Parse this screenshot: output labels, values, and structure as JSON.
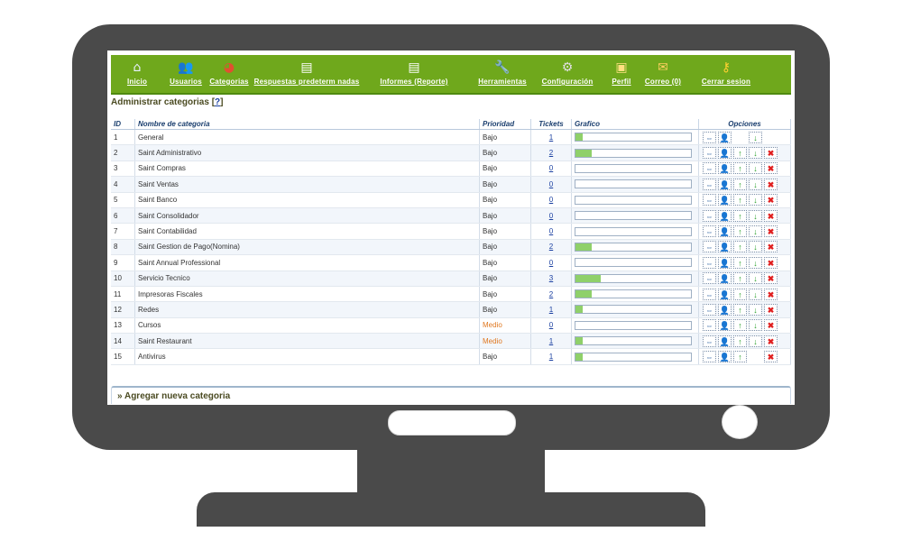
{
  "nav": {
    "items": [
      {
        "label": "Inicio",
        "icon": "home-icon",
        "glyph": "⌂",
        "color": "#e8f0ff"
      },
      {
        "label": "Usuarios",
        "icon": "users-icon",
        "glyph": "👥",
        "color": "#bcd8ff"
      },
      {
        "label": "Categorias",
        "icon": "pie-chart-icon",
        "glyph": "◕",
        "color": "#e05030"
      },
      {
        "label": "Respuestas predeterm nadas",
        "icon": "document-add-icon",
        "glyph": "▤",
        "color": "#ffffff"
      },
      {
        "label": "Informes (Reporte)",
        "icon": "report-icon",
        "glyph": "▤",
        "color": "#ffffff"
      },
      {
        "label": "Herramientas",
        "icon": "wrench-icon",
        "glyph": "🔧",
        "color": "#c0d8ff"
      },
      {
        "label": "Configuración",
        "icon": "gear-icon",
        "glyph": "⚙",
        "color": "#e0e0e0"
      },
      {
        "label": "Perfil",
        "icon": "profile-card-icon",
        "glyph": "▣",
        "color": "#ffe080"
      },
      {
        "label": "Correo (0)",
        "icon": "mail-icon",
        "glyph": "✉",
        "color": "#ffd060"
      },
      {
        "label": "Cerrar sesion",
        "icon": "key-icon",
        "glyph": "⚷",
        "color": "#ffd030"
      }
    ]
  },
  "page": {
    "title": "Administrar categorias",
    "help": "?"
  },
  "table": {
    "headers": {
      "id": "ID",
      "name": "Nombre de categoria",
      "priority": "Prioridad",
      "tickets": "Tickets",
      "graph": "Grafico",
      "options": "Opciones"
    },
    "rows": [
      {
        "id": "1",
        "name": "General",
        "priority": "Bajo",
        "tickets": "1",
        "bar": 0.06,
        "up": false,
        "down": true,
        "del": false
      },
      {
        "id": "2",
        "name": "Saint Administrativo",
        "priority": "Bajo",
        "tickets": "2",
        "bar": 0.14,
        "up": true,
        "down": true,
        "del": true
      },
      {
        "id": "3",
        "name": "Saint Compras",
        "priority": "Bajo",
        "tickets": "0",
        "bar": 0,
        "up": true,
        "down": true,
        "del": true
      },
      {
        "id": "4",
        "name": "Saint Ventas",
        "priority": "Bajo",
        "tickets": "0",
        "bar": 0,
        "up": true,
        "down": true,
        "del": true
      },
      {
        "id": "5",
        "name": "Saint Banco",
        "priority": "Bajo",
        "tickets": "0",
        "bar": 0,
        "up": true,
        "down": true,
        "del": true
      },
      {
        "id": "6",
        "name": "Saint Consolidador",
        "priority": "Bajo",
        "tickets": "0",
        "bar": 0,
        "up": true,
        "down": true,
        "del": true
      },
      {
        "id": "7",
        "name": "Saint Contabilidad",
        "priority": "Bajo",
        "tickets": "0",
        "bar": 0,
        "up": true,
        "down": true,
        "del": true
      },
      {
        "id": "8",
        "name": "Saint Gestion de Pago(Nomina)",
        "priority": "Bajo",
        "tickets": "2",
        "bar": 0.14,
        "up": true,
        "down": true,
        "del": true
      },
      {
        "id": "9",
        "name": "Saint Annual Professional",
        "priority": "Bajo",
        "tickets": "0",
        "bar": 0,
        "up": true,
        "down": true,
        "del": true
      },
      {
        "id": "10",
        "name": "Servicio Tecnico",
        "priority": "Bajo",
        "tickets": "3",
        "bar": 0.22,
        "up": true,
        "down": true,
        "del": true
      },
      {
        "id": "11",
        "name": "Impresoras Fiscales",
        "priority": "Bajo",
        "tickets": "2",
        "bar": 0.14,
        "up": true,
        "down": true,
        "del": true
      },
      {
        "id": "12",
        "name": "Redes",
        "priority": "Bajo",
        "tickets": "1",
        "bar": 0.06,
        "up": true,
        "down": true,
        "del": true
      },
      {
        "id": "13",
        "name": "Cursos",
        "priority": "Medio",
        "tickets": "0",
        "bar": 0,
        "up": true,
        "down": true,
        "del": true
      },
      {
        "id": "14",
        "name": "Saint Restaurant",
        "priority": "Medio",
        "tickets": "1",
        "bar": 0.06,
        "up": true,
        "down": true,
        "del": true
      },
      {
        "id": "15",
        "name": "Antivirus",
        "priority": "Bajo",
        "tickets": "1",
        "bar": 0.06,
        "up": true,
        "down": false,
        "del": true
      }
    ]
  },
  "footer": {
    "add_category": "» Agregar nueva categoria"
  },
  "colors": {
    "nav_bg": "#6fa81c",
    "bar_fill": "#8fd06a",
    "priority_medio": "#e07820",
    "monitor": "#4a4a4a"
  }
}
